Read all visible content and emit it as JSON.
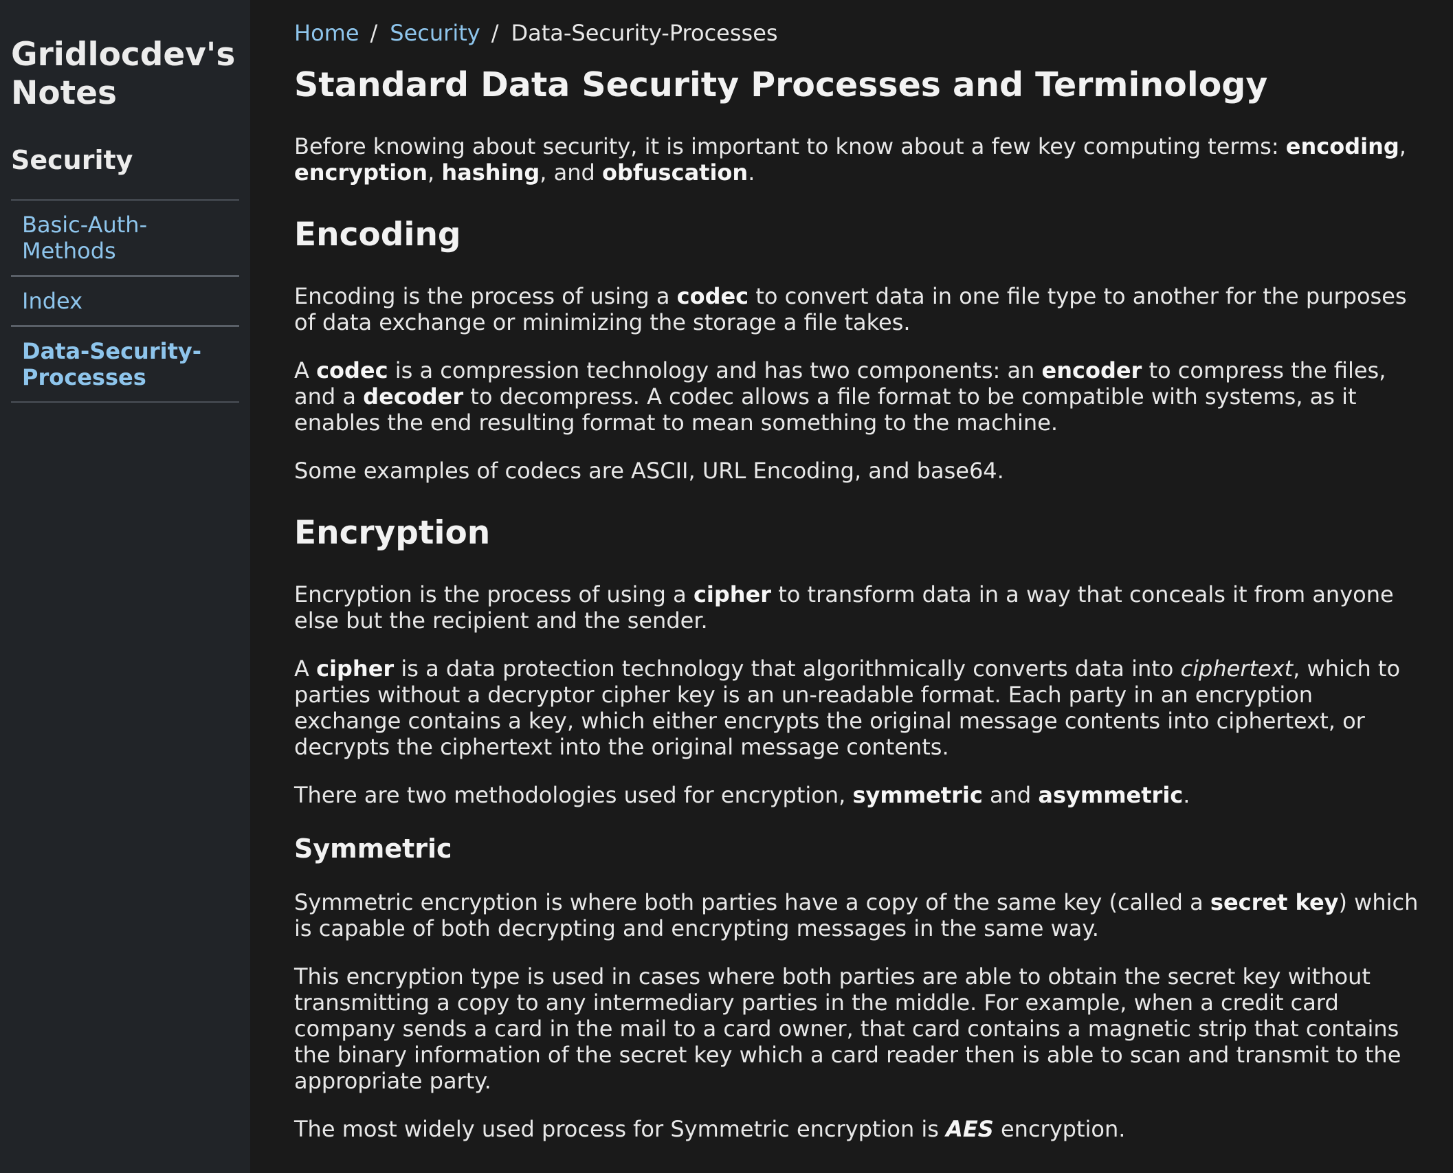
{
  "sidebar": {
    "site_title": "Gridlocdev's Notes",
    "section_title": "Security",
    "items": [
      {
        "label": "Basic-Auth-Methods"
      },
      {
        "label": "Index"
      },
      {
        "label": "Data-Security-Processes",
        "active": true
      }
    ]
  },
  "breadcrumb": {
    "home": "Home",
    "separator": "/",
    "section": "Security",
    "current": "Data-Security-Processes"
  },
  "article": {
    "title": "Standard Data Security Processes and Terminology",
    "intro": {
      "t1": "Before knowing about security, it is important to know about a few key computing terms: ",
      "b1": "encoding",
      "t2": ", ",
      "b2": "encryption",
      "t3": ", ",
      "b3": "hashing",
      "t4": ", and ",
      "b4": "obfuscation",
      "t5": "."
    },
    "encoding": {
      "heading": "Encoding",
      "p1": {
        "t1": "Encoding is the process of using a ",
        "b1": "codec",
        "t2": " to convert data in one file type to another for the purposes of data exchange or minimizing the storage a file takes."
      },
      "p2": {
        "t1": "A ",
        "b1": "codec",
        "t2": " is a compression technology and has two components: an ",
        "b2": "encoder",
        "t3": " to compress the files, and a ",
        "b3": "decoder",
        "t4": " to decompress. A codec allows a file format to be compatible with systems, as it enables the end resulting format to mean something to the machine."
      },
      "p3": "Some examples of codecs are ASCII, URL Encoding, and base64."
    },
    "encryption": {
      "heading": "Encryption",
      "p1": {
        "t1": "Encryption is the process of using a ",
        "b1": "cipher",
        "t2": " to transform data in a way that conceals it from anyone else but the recipient and the sender."
      },
      "p2": {
        "t1": "A ",
        "b1": "cipher",
        "t2": " is a data protection technology that algorithmically converts data into ",
        "i1": "ciphertext",
        "t3": ", which to parties without a decryptor cipher key is an un-readable format. Each party in an encryption exchange contains a key, which either encrypts the original message contents into ciphertext, or decrypts the ciphertext into the original message contents."
      },
      "p3": {
        "t1": "There are two methodologies used for encryption, ",
        "b1": "symmetric",
        "t2": " and ",
        "b2": "asymmetric",
        "t3": "."
      }
    },
    "symmetric": {
      "heading": "Symmetric",
      "p1": {
        "t1": "Symmetric encryption is where both parties have a copy of the same key (called a ",
        "b1": "secret key",
        "t2": ") which is capable of both decrypting and encrypting messages in the same way."
      },
      "p2": "This encryption type is used in cases where both parties are able to obtain the secret key without transmitting a copy to any intermediary parties in the middle. For example, when a credit card company sends a card in the mail to a card owner, that card contains a magnetic strip that contains the binary information of the secret key which a card reader then is able to scan and transmit to the appropriate party.",
      "p3": {
        "t1": "The most widely used process for Symmetric encryption is ",
        "bi1": "AES",
        "t2": " encryption."
      }
    }
  }
}
